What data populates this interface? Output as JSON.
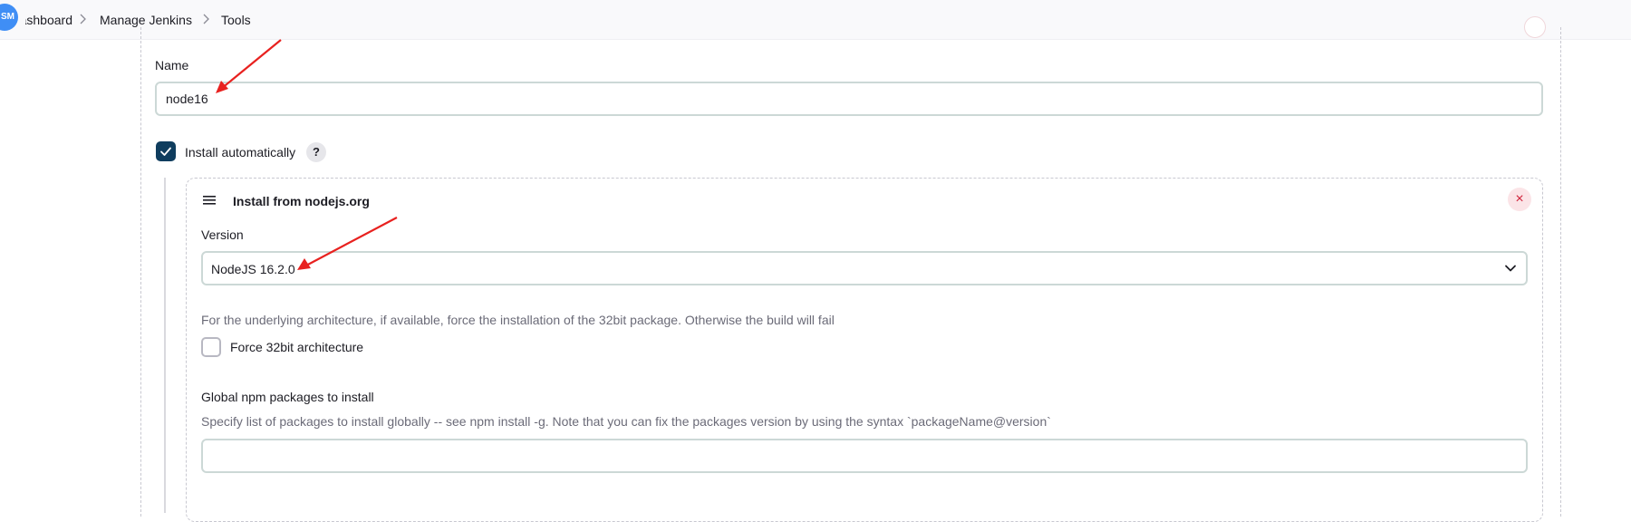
{
  "header": {
    "avatar_text": "SM",
    "breadcrumbs": [
      "Dashboard",
      "Manage Jenkins",
      "Tools"
    ]
  },
  "form": {
    "name_label": "Name",
    "name_value": "node16",
    "install_auto_label": "Install automatically",
    "install_auto_checked": true,
    "help_glyph": "?",
    "installer": {
      "title": "Install from nodejs.org",
      "close_glyph": "×",
      "version_label": "Version",
      "version_value": "NodeJS 16.2.0",
      "force32_description": "For the underlying architecture, if available, force the installation of the 32bit package. Otherwise the build will fail",
      "force32_label": "Force 32bit architecture",
      "force32_checked": false,
      "npm_label": "Global npm packages to install",
      "npm_description": "Specify list of packages to install globally -- see npm install -g. Note that you can fix the packages version by using the syntax `packageName@version`",
      "npm_value": ""
    }
  },
  "colors": {
    "checkbox_checked": "#0f3d5e",
    "annotation_arrow": "#e8211f",
    "close_icon": "#d0243c"
  },
  "icons": [
    "chevron-right-icon",
    "check-icon",
    "help-icon",
    "drag-handle-icon",
    "close-icon",
    "chevron-down-icon"
  ]
}
